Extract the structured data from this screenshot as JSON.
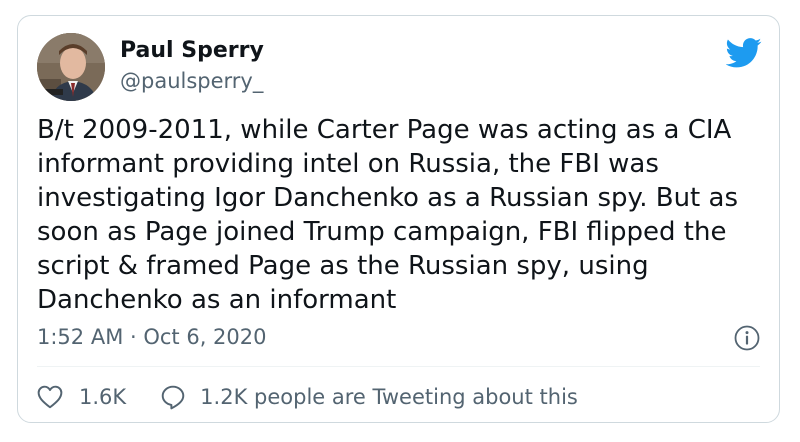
{
  "author": {
    "display_name": "Paul Sperry",
    "handle": "@paulsperry_",
    "avatar_icon": "person-photo"
  },
  "tweet": {
    "text": "B/t 2009-2011, while Carter Page was acting as a CIA\ninformant providing intel on Russia, the FBI was\ninvestigating Igor Danchenko as a Russian spy. But as\nsoon as Page joined Trump campaign, FBI flipped the\nscript & framed Page as the Russian spy, using\nDanchenko as an informant",
    "timestamp": "1:52 AM · Oct 6, 2020"
  },
  "actions": {
    "like_count": "1.6K",
    "discussion_label": "1.2K people are Tweeting about this"
  },
  "icons": {
    "brand": "twitter-bird-icon",
    "info": "info-icon",
    "like": "heart-icon",
    "discussion": "speech-bubble-icon"
  },
  "colors": {
    "brand_blue": "#1d9bf0",
    "text_primary": "#0f1419",
    "text_secondary": "#536471",
    "border": "#cfd9de"
  }
}
